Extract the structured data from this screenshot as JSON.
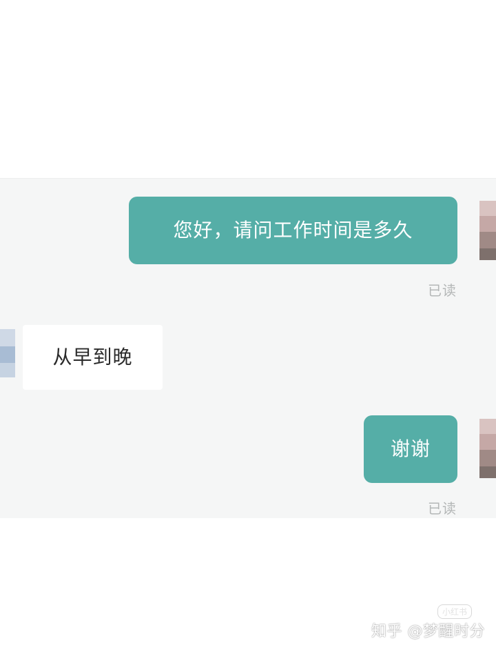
{
  "messages": [
    {
      "direction": "sent",
      "text": "您好，请问工作时间是多久",
      "receipt": "已读"
    },
    {
      "direction": "received",
      "text": "从早到晚"
    },
    {
      "direction": "sent",
      "text": "谢谢",
      "receipt": "已读"
    }
  ],
  "watermark": {
    "text": "知乎 @梦醒时分",
    "badge": "小红书"
  },
  "colors": {
    "sent_bubble": "#55aea7",
    "received_bubble": "#ffffff",
    "chat_background": "#f5f6f6",
    "receipt_text": "#b4b7b7"
  },
  "icons": {
    "self_avatar": "pixelated-avatar-icon",
    "peer_avatar": "pixelated-avatar-icon"
  }
}
